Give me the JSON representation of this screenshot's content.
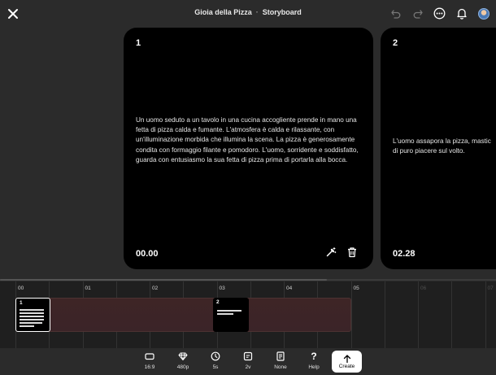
{
  "header": {
    "project_title": "Gioia della Pizza",
    "separator": "·",
    "view_title": "Storyboard"
  },
  "icons": {
    "close": "close-icon",
    "undo": "undo-icon",
    "redo": "redo-icon",
    "more": "more-icon",
    "notifications": "bell-icon",
    "avatar": "avatar"
  },
  "scenes": [
    {
      "number": "1",
      "description": "Un uomo seduto a un tavolo in una cucina accogliente prende in mano una fetta di pizza calda e fumante. L'atmosfera è calda e rilassante, con un'illuminazione morbida che illumina la scena. La pizza è generosamente condita con formaggio filante e pomodoro. L'uomo, sorridente e soddisfatto, guarda con entusiasmo la sua fetta di pizza prima di portarla alla bocca.",
      "time": "00.00"
    },
    {
      "number": "2",
      "description": "L'uomo assapora la pizza, mastic\ndi puro piacere sul volto.",
      "time": "02.28"
    }
  ],
  "timeline": {
    "labels": [
      "00",
      "01",
      "02",
      "03",
      "04",
      "05",
      "06",
      "07"
    ],
    "clips": [
      {
        "number": "1",
        "selected": true
      },
      {
        "number": "2",
        "selected": false
      }
    ]
  },
  "toolbar": {
    "items": [
      {
        "label": "16:9",
        "icon": "aspect-ratio-icon"
      },
      {
        "label": "480p",
        "icon": "diamond-icon"
      },
      {
        "label": "5s",
        "icon": "clock-icon"
      },
      {
        "label": "2v",
        "icon": "versions-icon"
      },
      {
        "label": "None",
        "icon": "document-icon"
      },
      {
        "label": "Help",
        "icon": "question-icon"
      }
    ],
    "create_label": "Create"
  },
  "colors": {
    "background": "#2b2b2b",
    "card": "#000000",
    "timeline_clip": "#3e2526",
    "create_button": "#ffffff"
  }
}
